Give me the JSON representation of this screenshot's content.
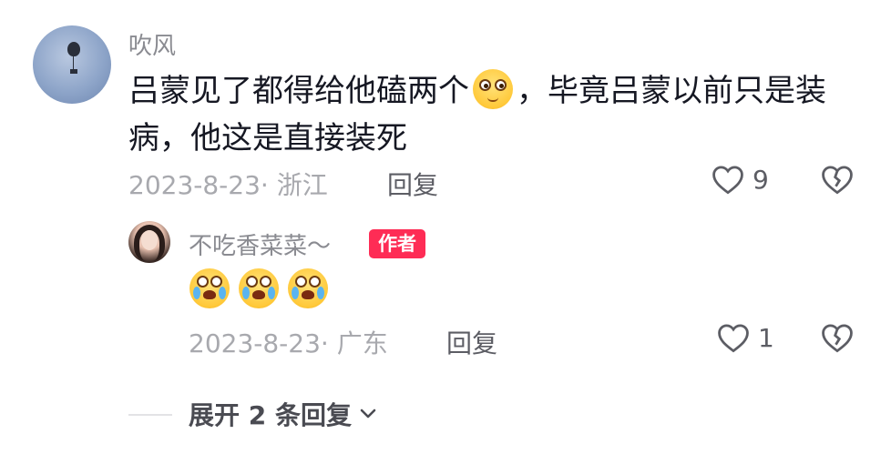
{
  "comment": {
    "username": "吹风",
    "text_part1": "吕蒙见了都得给他磕两个",
    "emoji": "smile-emoji",
    "text_part2": "，毕竟吕蒙以前只是装病，他这是直接装死",
    "date_location": "2023-8-23· 浙江",
    "reply_label": "回复",
    "like_count": "9"
  },
  "reply": {
    "username": "不吃香菜菜～",
    "badge": "作者",
    "emojis": [
      "cry-laugh-emoji",
      "cry-laugh-emoji",
      "cry-laugh-emoji"
    ],
    "date_location": "2023-8-23· 广东",
    "reply_label": "回复",
    "like_count": "1"
  },
  "expand_label": "展开 2 条回复",
  "colors": {
    "author_badge": "#fe2c55",
    "meta_gray": "#a8a9ae",
    "text": "#161823"
  }
}
